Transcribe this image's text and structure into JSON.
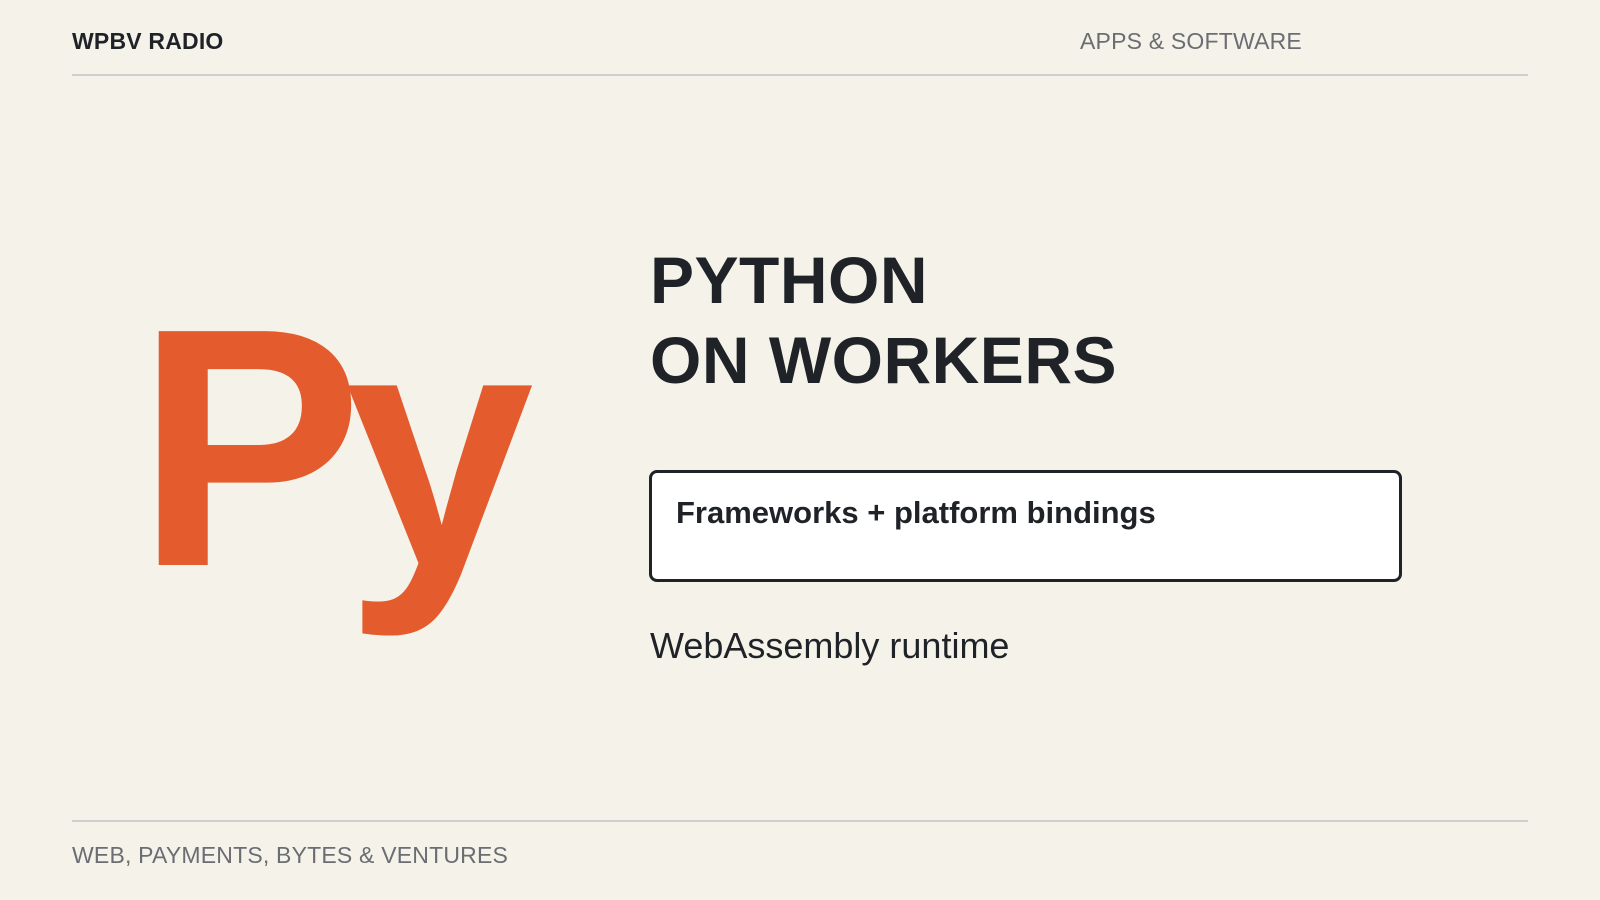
{
  "header": {
    "brand": "WPBV RADIO",
    "section": "APPS & SOFTWARE"
  },
  "logo": {
    "text": "Py",
    "color": "#e45b2d"
  },
  "title": {
    "line1": "PYTHON",
    "line2": "ON WORKERS"
  },
  "highlight": {
    "label": "Frameworks + platform bindings"
  },
  "subtitle": {
    "text": "WebAssembly runtime"
  },
  "footer": {
    "text": "WEB, PAYMENTS, BYTES & VENTURES"
  },
  "colors": {
    "background": "#f5f2ea",
    "text": "#1f2328",
    "muted": "#6a6d72",
    "accent": "#e45b2d"
  }
}
